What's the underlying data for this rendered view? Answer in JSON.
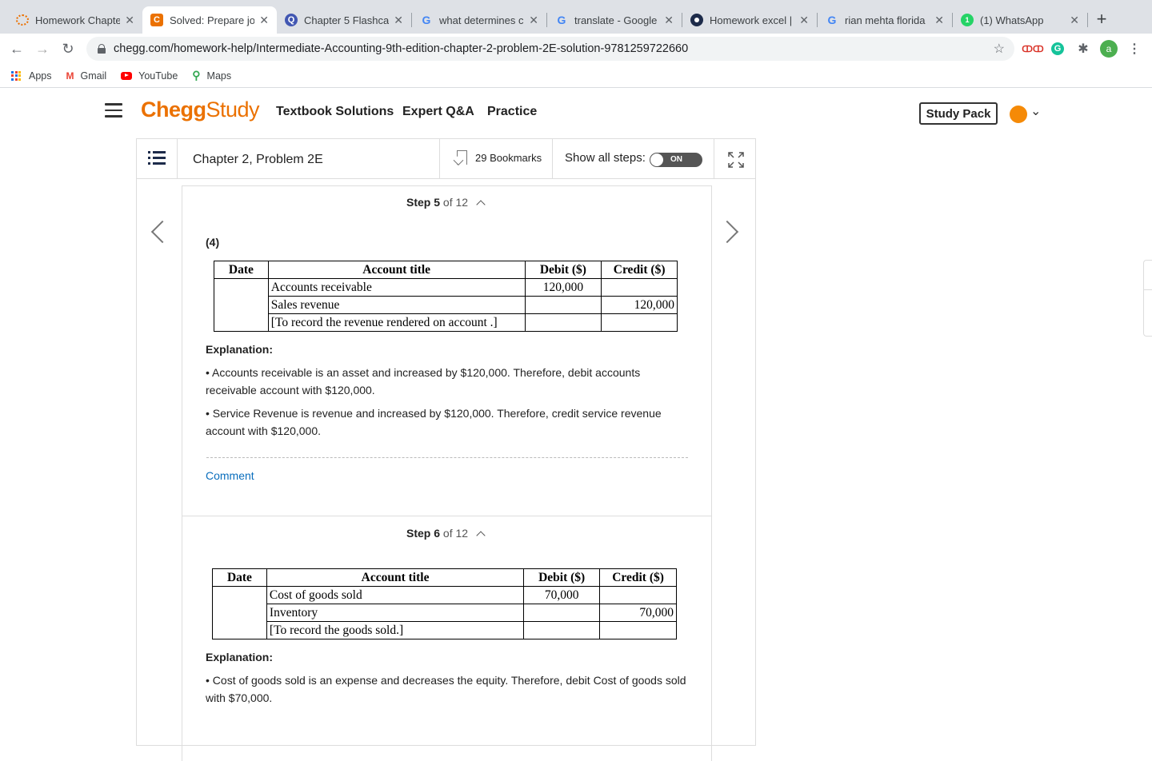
{
  "browser": {
    "tabs": [
      {
        "title": "Homework Chapte",
        "icon": "chegg-loading-icon",
        "active": false
      },
      {
        "title": "Solved: Prepare jo",
        "icon": "chegg-c-icon",
        "active": true
      },
      {
        "title": "Chapter 5 Flashca",
        "icon": "quizlet-q-icon",
        "active": false
      },
      {
        "title": "what determines c",
        "icon": "google-g-icon",
        "active": false
      },
      {
        "title": "translate - Google",
        "icon": "google-g-icon",
        "active": false
      },
      {
        "title": "Homework excel |",
        "icon": "openai-icon",
        "active": false
      },
      {
        "title": "rian mehta florida",
        "icon": "google-g-icon",
        "active": false
      },
      {
        "title": "(1) WhatsApp",
        "icon": "whatsapp-icon",
        "active": false
      }
    ],
    "url": "chegg.com/homework-help/Intermediate-Accounting-9th-edition-chapter-2-problem-2E-solution-9781259722660",
    "profile_initial": "a",
    "bookmarks": [
      {
        "label": "Apps"
      },
      {
        "label": "Gmail"
      },
      {
        "label": "YouTube"
      },
      {
        "label": "Maps"
      }
    ]
  },
  "header": {
    "logo_brand": "Chegg",
    "logo_product": "Study",
    "nav": [
      "Textbook Solutions",
      "Expert Q&A",
      "Practice"
    ],
    "study_pack": "Study Pack"
  },
  "problem": {
    "title": "Chapter 2, Problem 2E",
    "bookmarks": "29 Bookmarks",
    "show_all_steps": "Show all steps:",
    "toggle": "ON"
  },
  "steps": [
    {
      "step_word": "Step",
      "number": "5",
      "of_total": "of 12",
      "part": "(4)",
      "columns": [
        "Date",
        "Account title",
        "Debit ($)",
        "Credit ($)"
      ],
      "rows": [
        {
          "date": "",
          "account": "Accounts receivable",
          "debit": "120,000",
          "credit": ""
        },
        {
          "date": "",
          "account": "Sales revenue",
          "debit": "",
          "credit": "120,000"
        },
        {
          "date": "",
          "account": "[To record the revenue rendered on account .]",
          "debit": "",
          "credit": ""
        }
      ],
      "explanation_heading": "Explanation:",
      "explanation": [
        "• Accounts receivable is an asset and increased by $120,000. Therefore, debit accounts receivable account with $120,000.",
        "• Service Revenue is revenue and increased by $120,000. Therefore, credit service revenue account with $120,000."
      ],
      "comment": "Comment"
    },
    {
      "step_word": "Step",
      "number": "6",
      "of_total": "of 12",
      "columns": [
        "Date",
        "Account title",
        "Debit ($)",
        "Credit ($)"
      ],
      "rows": [
        {
          "date": "",
          "account": "Cost of goods sold",
          "debit": "70,000",
          "credit": ""
        },
        {
          "date": "",
          "account": "Inventory",
          "debit": "",
          "credit": "70,000"
        },
        {
          "date": "",
          "account": "[To record the goods sold.]",
          "debit": "",
          "credit": ""
        }
      ],
      "explanation_heading": "Explanation:",
      "explanation": [
        "• Cost of goods sold is an expense and decreases the equity. Therefore, debit Cost of goods sold with $70,000."
      ]
    }
  ],
  "colors": {
    "chegg_orange": "#eb7100",
    "link_blue": "#0a6ebd",
    "toggle_gray": "#555555",
    "avatar_orange": "#f58a07"
  }
}
